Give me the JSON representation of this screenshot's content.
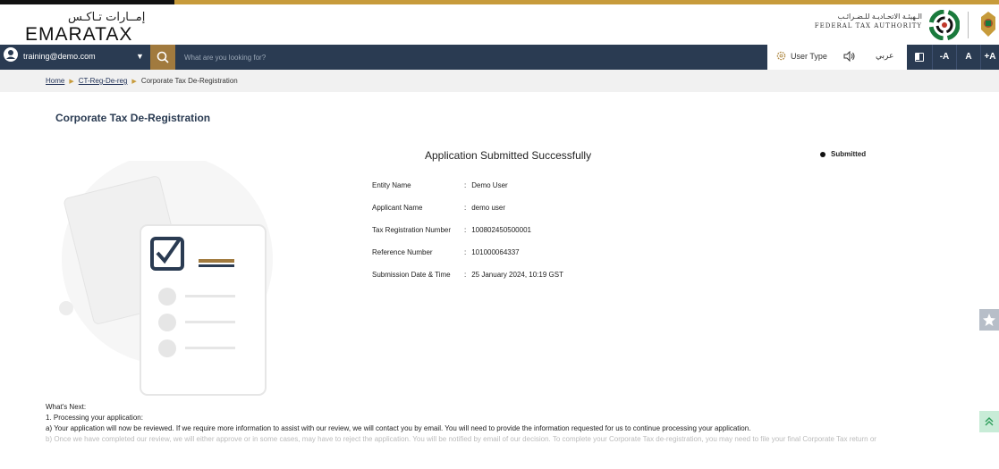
{
  "header": {
    "logo_ar": "إمــارات تـاكـس",
    "logo_en": "EMARATAX",
    "fta_ar": "الـهيئـة الاتحـاديـة للـضـرائـب",
    "fta_en": "FEDERAL TAX AUTHORITY"
  },
  "navbar": {
    "user_email": "training@demo.com",
    "search_placeholder": "What are you looking for?",
    "user_type_label": "User Type",
    "language_label": "عربي",
    "font_decrease": "-A",
    "font_normal": "A",
    "font_increase": "+A"
  },
  "breadcrumb": {
    "home": "Home",
    "parent": "CT-Reg-De-reg",
    "current": "Corporate Tax De-Registration"
  },
  "page": {
    "title": "Corporate Tax De-Registration",
    "success_message": "Application Submitted Successfully",
    "status": "Submitted"
  },
  "details": [
    {
      "label": "Entity Name",
      "value": "Demo User"
    },
    {
      "label": "Applicant Name",
      "value": "demo user"
    },
    {
      "label": "Tax Registration Number",
      "value": "100802450500001"
    },
    {
      "label": "Reference Number",
      "value": "101000064337"
    },
    {
      "label": "Submission Date & Time",
      "value": "25 January 2024, 10:19 GST"
    }
  ],
  "next_steps": {
    "heading": "What's Next:",
    "step1_title": "1. Processing your application:",
    "step1_a": "a) Your application will now be reviewed. If we require more information to assist with our review, we will contact you by email. You will need to provide the information requested for us to continue processing your application.",
    "step1_b": "b) Once we have completed our review, we will either approve or in some cases, may have to reject the application. You will be notified by email of our decision. To complete your Corporate Tax de-registration, you may need to file your final Corporate Tax return or"
  },
  "colors": {
    "navy": "#2a3b52",
    "gold": "#a17a3e",
    "accent_gold": "#c79b3b"
  }
}
